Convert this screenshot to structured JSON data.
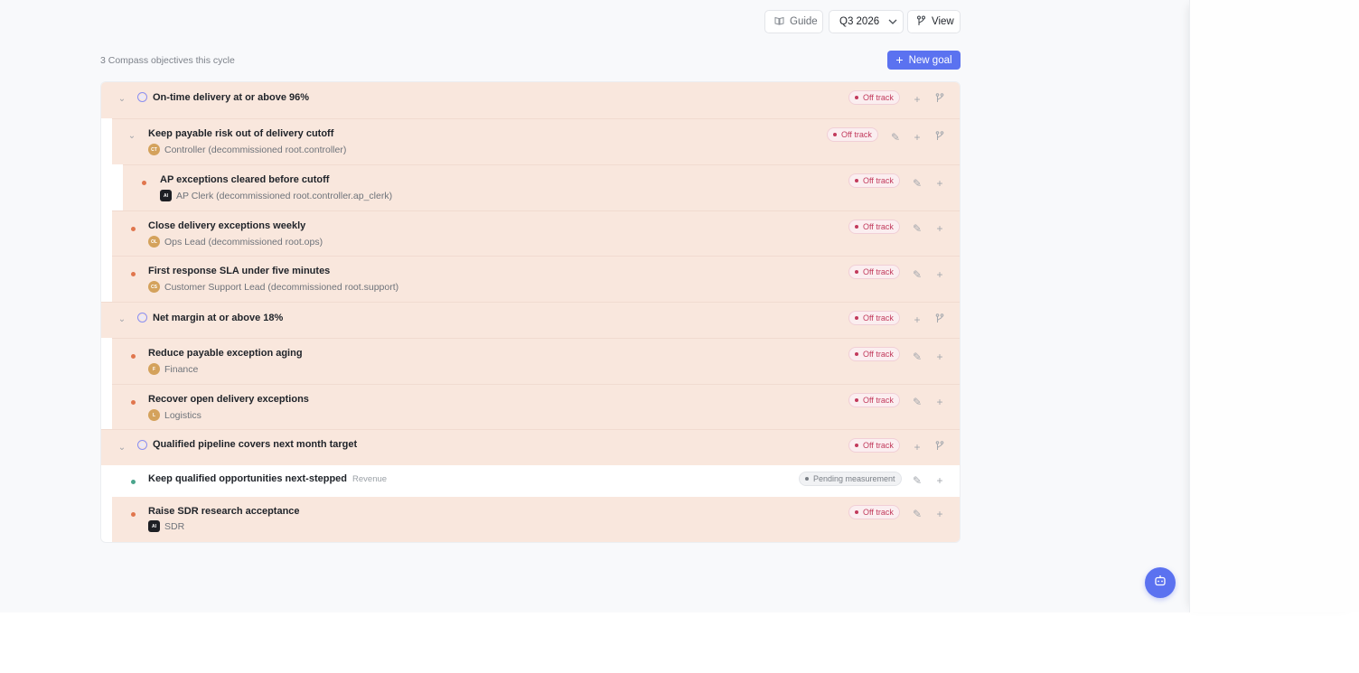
{
  "toolbar": {
    "guide_label": "Guide",
    "cycle_value": "Q3 2026",
    "view_label": "View",
    "new_goal_label": "New goal"
  },
  "summary": "3 Compass objectives this cycle",
  "rows": [
    {
      "title": "On-time delivery at or above 96%",
      "status": "Off track"
    },
    {
      "title": "Keep payable risk out of delivery cutoff",
      "owner": "Controller (decommissioned root.controller)",
      "initials": "CT",
      "status": "Off track"
    },
    {
      "title": "AP exceptions cleared before cutoff",
      "owner": "AP Clerk (decommissioned root.controller.ap_clerk)",
      "initials": "AI",
      "status": "Off track"
    },
    {
      "title": "Close delivery exceptions weekly",
      "owner": "Ops Lead (decommissioned root.ops)",
      "initials": "OL",
      "status": "Off track"
    },
    {
      "title": "First response SLA under five minutes",
      "owner": "Customer Support Lead (decommissioned root.support)",
      "initials": "CS",
      "status": "Off track"
    },
    {
      "title": "Net margin at or above 18%",
      "status": "Off track"
    },
    {
      "title": "Reduce payable exception aging",
      "owner": "Finance",
      "initials": "F",
      "status": "Off track"
    },
    {
      "title": "Recover open delivery exceptions",
      "owner": "Logistics",
      "initials": "L",
      "status": "Off track"
    },
    {
      "title": "Qualified pipeline covers next month target",
      "status": "Off track"
    },
    {
      "title": "Keep qualified opportunities next-stepped",
      "tag": "Revenue",
      "status": "Pending measurement"
    },
    {
      "title": "Raise SDR research acceptance",
      "owner": "SDR",
      "initials": "AI",
      "status": "Off track"
    }
  ],
  "colors": {
    "accent": "#5b72f0",
    "off_track": "#c23a5c",
    "row_background": "#f9e7dd"
  },
  "icons": [
    "book-icon",
    "chevron-down-icon",
    "branch-icon",
    "plus-icon",
    "target-icon",
    "pencil-icon",
    "bot-icon"
  ]
}
